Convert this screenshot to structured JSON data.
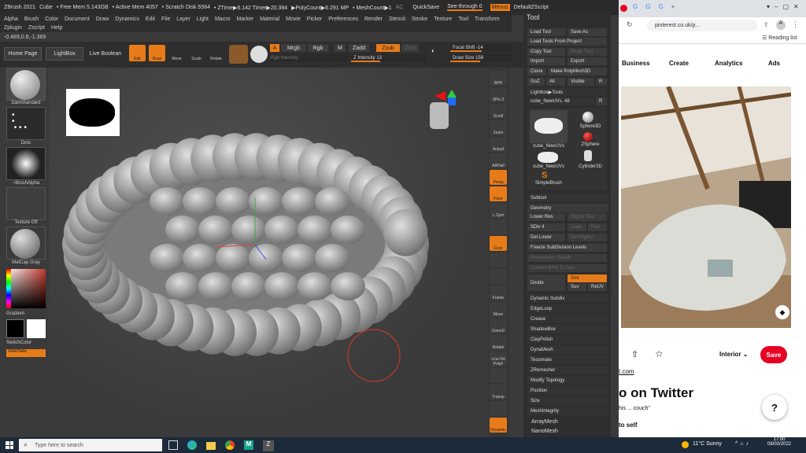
{
  "zbrush": {
    "title": {
      "app": "ZBrush 2021",
      "file": "Cube",
      "free_mem": "• Free Mem 5.143GB",
      "active_mem": "• Active Mem 4057",
      "scratch": "• Scratch Disk 5564",
      "ztime": "• ZTime▶6.142 Timer▶20.384",
      "polycount": "▶PolyCount▶6.291 MP",
      "meshcount": "• MeshCount▶1",
      "ac": "AC",
      "quicksave": "QuickSave",
      "see_through": "See-through  0",
      "menus": "Menus",
      "default_script": "DefaultZScript"
    },
    "menu_row1": [
      "Alpha",
      "Brush",
      "Color",
      "Document",
      "Draw",
      "Dynamics",
      "Edit",
      "File",
      "Layer",
      "Light",
      "Macro",
      "Marker",
      "Material",
      "Movie",
      "Picker",
      "Preferences",
      "Render",
      "Stencil",
      "Stroke",
      "Texture",
      "Tool",
      "Transform"
    ],
    "menu_row2": [
      "Zplugin",
      "Zscript",
      "Help"
    ],
    "coords": "-0.489,0.8,-1.369",
    "shelf": {
      "home_page": "Home Page",
      "lightbox": "LightBox",
      "live_boolean": "Live Boolean",
      "edit": "Edit",
      "draw": "Draw",
      "move": "Move",
      "scale": "Scale",
      "rotate": "Rotate",
      "a": "A",
      "mrgb": "Mrgb",
      "rgb": "Rgb",
      "m": "M",
      "zadd": "Zadd",
      "zsub": "Zsub",
      "zcut": "Zcut",
      "rgb_intensity": "Rgb Intensity",
      "z_intensity": "Z Intensity 13",
      "focal_shift": "Focal Shift -14",
      "draw_size": "Draw Size 158",
      "z_intensity_level": 0.13,
      "draw_size_level": 0.16
    },
    "left": {
      "brush": "DamStandard",
      "stroke": "Dots",
      "alpha": "~BrushAlpha",
      "texture": "Texture Off",
      "material": "MatCap Gray",
      "gradient": "Gradient",
      "switch_color": "SwitchColor",
      "alternate": "Alternate"
    },
    "right_strip": [
      "BPR",
      "SPix 3",
      "Scroll",
      "Zoom",
      "Actual",
      "AAHalf",
      "Persp",
      "Floor",
      "L.Sym",
      "",
      "Gxyz",
      "",
      "",
      "Frame",
      "Move",
      "ZoomD",
      "Rotate",
      "Line Fill PolyF",
      "",
      "Transp",
      "",
      "Dynamic"
    ],
    "tool_panel": {
      "header": "Tool",
      "load_tool": "Load Tool",
      "save_as": "Save As",
      "load_from_project": "Load Tools From Project",
      "copy_tool": "Copy Tool",
      "paste_tool": "Paste Tool",
      "import": "Import",
      "export": "Export",
      "clone": "Clone",
      "make_polymesh": "Make PolyMesh3D",
      "goz": "GoZ",
      "all": "All",
      "visible": "Visible",
      "r": "R",
      "lightbox_tools": "Lightbox▶Tools",
      "current_tool": "cube_NewUVs. 48",
      "tool_thumbs": [
        "cube_NewUVs",
        "Sphere3D",
        "ZSphere",
        "cube_NewUVs",
        "Cylinder3D",
        "SimpleBrush"
      ],
      "subtool": "Subtool",
      "geometry": "Geometry",
      "lower_res": "Lower Res",
      "higher_res": "Higher Res",
      "sdiv": "SDiv 4",
      "cage": "Cage",
      "rstr": "Rstr",
      "del_lower": "Del Lower",
      "del_higher": "Del Higher",
      "freeze": "Freeze SubDivision Levels",
      "reconstruct": "Reconstruct Subdiv",
      "convert_bpr": "Convert BPR To Geo",
      "divide": "Divide",
      "smt": "Smt",
      "suv": "Suv",
      "reuv": "ReUV",
      "sections": [
        "Dynamic Subdiv",
        "EdgeLoop",
        "Crease",
        "ShadowBox",
        "ClayPolish",
        "DynaMesh",
        "Tessimate",
        "ZRemesher",
        "Modify Topology",
        "Position",
        "Size",
        "MeshIntegrity"
      ],
      "after": [
        "ArrayMesh",
        "NanoMesh"
      ]
    }
  },
  "browser": {
    "tab_icons": [
      "G",
      "G",
      "G",
      "+"
    ],
    "url": "pinterest.co.uk/p...",
    "reading_list": "Reading list",
    "nav": [
      "Business",
      "Create",
      "Analytics",
      "Ads"
    ],
    "board": "Interior",
    "save": "Save",
    "link_fragment": "t.com",
    "heading": "o on Twitter",
    "quote": "his ... couch\"",
    "to_self": "to self",
    "help": "?"
  },
  "taskbar": {
    "search_placeholder": "Type here to search",
    "weather": "11°C  Sunny",
    "time": "17:00",
    "date": "08/03/2022"
  },
  "colors": {
    "accent": "#e87b19",
    "pinterest_red": "#e60023"
  }
}
